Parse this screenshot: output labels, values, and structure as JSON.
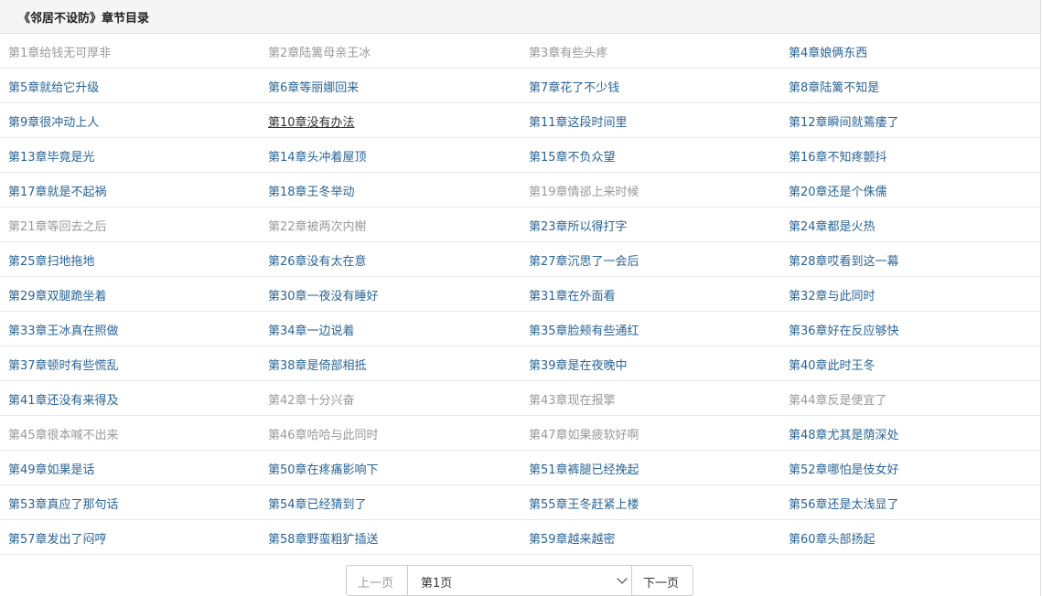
{
  "header": {
    "title": "《邻居不设防》章节目录"
  },
  "chapters": [
    [
      "第1章给钱无可厚非",
      "第2章陆篱母亲王冰",
      "第3章有些头疼",
      "第4章娘俩东西"
    ],
    [
      "第5章就给它升级",
      "第6章等丽娜回来",
      "第7章花了不少钱",
      "第8章陆篱不知是"
    ],
    [
      "第9章很冲动上人",
      "第10章没有办法",
      "第11章这段时间里",
      "第12章瞬间就蔫痿了"
    ],
    [
      "第13章毕竟是光",
      "第14章头冲着屋顶",
      "第15章不负众望",
      "第16章不知疼颤抖"
    ],
    [
      "第17章就是不起祸",
      "第18章王冬举动",
      "第19章情郤上来时候",
      "第20章还是个侏儒"
    ],
    [
      "第21章等回去之后",
      "第22章被两次内榭",
      "第23章所以得打字",
      "第24章都是火热"
    ],
    [
      "第25章扫地拖地",
      "第26章没有太在意",
      "第27章沉思了一会后",
      "第28章哎看到这一幕"
    ],
    [
      "第29章双腿跪坐着",
      "第30章一夜没有睡好",
      "第31章在外面看",
      "第32章与此同时"
    ],
    [
      "第33章王冰真在照做",
      "第34章一边说着",
      "第35章脸颊有些通红",
      "第36章好在反应够快"
    ],
    [
      "第37章顿时有些慌乱",
      "第38章是倚部相抵",
      "第39章是在夜晚中",
      "第40章此时王冬"
    ],
    [
      "第41章还没有来得及",
      "第42章十分兴奋",
      "第43章现在报擎",
      "第44章反是便宜了"
    ],
    [
      "第45章很本喊不出来",
      "第46章哈哈与此同时",
      "第47章如果疲软好啊",
      "第48章尤其是荫深处"
    ],
    [
      "第49章如果是话",
      "第50章在疼痛影响下",
      "第51章裤腿已经挽起",
      "第52章哪怕是伎女好"
    ],
    [
      "第53章真应了那句话",
      "第54章已经猜到了",
      "第55章王冬赶紧上楼",
      "第56章还是太浅显了"
    ],
    [
      "第57章发出了闷哼",
      "第58章野蛮粗犷插送",
      "第59章越来越密",
      "第60章头部扬起"
    ]
  ],
  "chapter_state": [
    [
      "dim",
      "dim",
      "dim",
      "link"
    ],
    [
      "link",
      "link",
      "link",
      "link"
    ],
    [
      "link",
      "current",
      "link",
      "link"
    ],
    [
      "link",
      "link",
      "link",
      "link"
    ],
    [
      "link",
      "link",
      "dim",
      "link"
    ],
    [
      "dim",
      "dim",
      "link",
      "link"
    ],
    [
      "link",
      "link",
      "link",
      "link"
    ],
    [
      "link",
      "link",
      "link",
      "link"
    ],
    [
      "link",
      "link",
      "link",
      "link"
    ],
    [
      "link",
      "link",
      "link",
      "link"
    ],
    [
      "link",
      "dim",
      "dim",
      "dim"
    ],
    [
      "dim",
      "dim",
      "dim",
      "link"
    ],
    [
      "link",
      "link",
      "link",
      "link"
    ],
    [
      "link",
      "link",
      "link",
      "link"
    ],
    [
      "link",
      "link",
      "link",
      "link"
    ]
  ],
  "pager": {
    "prev_label": "上一页",
    "selected_page": "第1页",
    "next_label": "下一页"
  },
  "colors": {
    "link": "#2a6496",
    "visited": "#999999",
    "header_bg": "#f5f5f5"
  }
}
